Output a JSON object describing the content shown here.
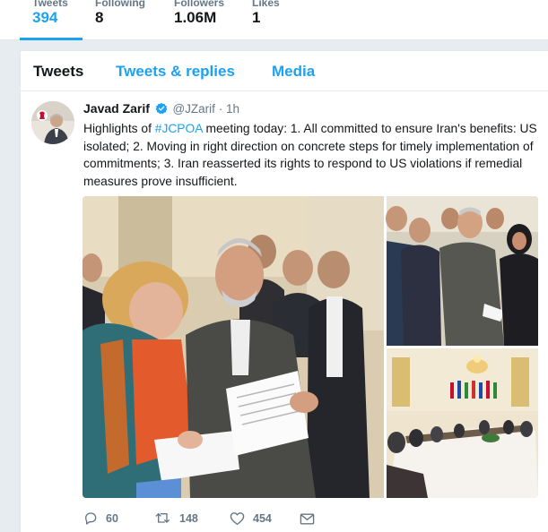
{
  "profile_stats": [
    {
      "label": "Tweets",
      "value": "394"
    },
    {
      "label": "Following",
      "value": "8"
    },
    {
      "label": "Followers",
      "value": "1.06M"
    },
    {
      "label": "Likes",
      "value": "1"
    }
  ],
  "tabs": [
    "Tweets",
    "Tweets & replies",
    "Media"
  ],
  "tweet": {
    "fullname": "Javad Zarif",
    "username": "@JZarif",
    "dot": "·",
    "time": "1h",
    "text_before": "Highlights of ",
    "hashtag": "#JCPOA",
    "text_after": " meeting today: 1. All committed to ensure Iran's benefits: US isolated; 2. Moving in right direction on concrete steps for timely implementation of commitments; 3. Iran reasserted its rights to respond to US violations if remedial measures prove insufficient.",
    "replies": "60",
    "retweets": "148",
    "likes": "454"
  },
  "icons": {
    "verified": "verified-badge-icon",
    "reply": "reply-icon",
    "retweet": "retweet-icon",
    "like": "heart-icon",
    "dm": "envelope-icon"
  },
  "colors": {
    "accent": "#1da1f2",
    "text": "#14171a",
    "muted": "#657786",
    "background": "#e6ecf0"
  }
}
